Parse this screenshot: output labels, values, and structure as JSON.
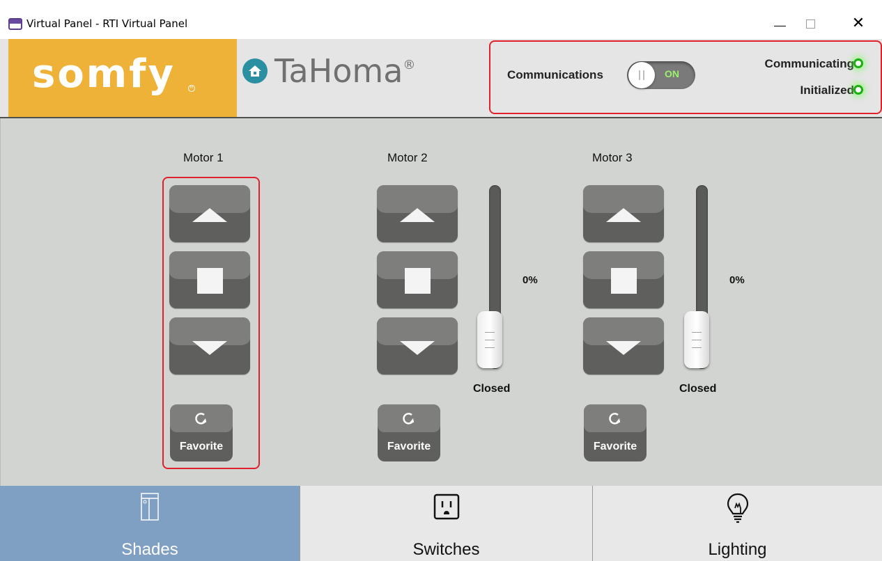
{
  "window": {
    "title": "Virtual Panel - RTI Virtual Panel",
    "icon": "app-icon",
    "controls": [
      "minimize-icon",
      "maximize-icon",
      "close-icon"
    ]
  },
  "header": {
    "brand": "somfy",
    "product": "TaHoma",
    "product_mark": "®",
    "communications_label": "Communications",
    "communications_toggle": {
      "state": "ON",
      "on": true
    },
    "status": [
      {
        "label": "Communicating",
        "led_color": "#19b010"
      },
      {
        "label": "Initialized",
        "led_color": "#19b010"
      }
    ]
  },
  "motors": [
    {
      "title": "Motor 1",
      "favorite_label": "Favorite",
      "has_slider": false
    },
    {
      "title": "Motor 2",
      "favorite_label": "Favorite",
      "has_slider": true,
      "position_percent": "0%",
      "position_state": "Closed",
      "slider_level": 0
    },
    {
      "title": "Motor 3",
      "favorite_label": "Favorite",
      "has_slider": true,
      "position_percent": "0%",
      "position_state": "Closed",
      "slider_level": 0
    }
  ],
  "tabs": [
    {
      "label": "Shades",
      "icon": "shades-icon",
      "active": true
    },
    {
      "label": "Switches",
      "icon": "outlet-icon",
      "active": false
    },
    {
      "label": "Lighting",
      "icon": "lightbulb-icon",
      "active": false
    }
  ],
  "colors": {
    "brand_orange": "#efb239",
    "highlight_red": "#e0202a",
    "active_tab": "#7f9fc3",
    "panel_bg": "#d2d4d1"
  }
}
